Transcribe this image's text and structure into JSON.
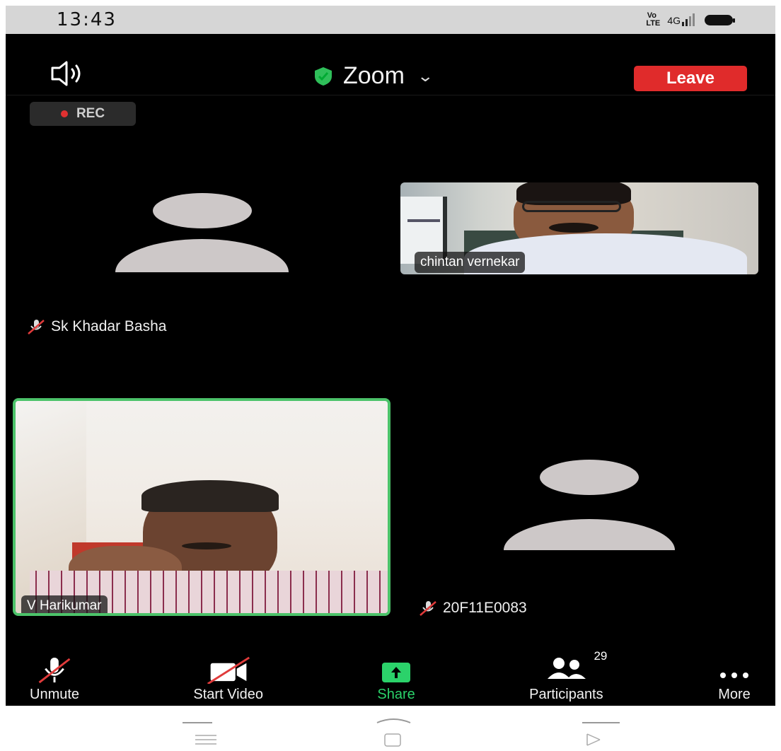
{
  "status": {
    "time": "13:43",
    "volte": "Vo\nLTE",
    "network": "4G"
  },
  "meeting": {
    "title": "Zoom",
    "leave_label": "Leave",
    "rec_label": "REC"
  },
  "participants": {
    "tile1_name": "Sk Khadar Basha",
    "tile2_name": "chintan vernekar",
    "tile3_name": "V Harikumar",
    "tile4_name": "20F11E0083"
  },
  "toolbar": {
    "unmute_label": "Unmute",
    "start_video_label": "Start Video",
    "share_label": "Share",
    "participants_label": "Participants",
    "participants_count": "29",
    "more_label": "More"
  },
  "colors": {
    "leave": "#e02b2b",
    "share": "#2bd26a",
    "active_speaker_border": "#4cc36a",
    "shield": "#2fbf5a"
  },
  "icons": [
    "speaker-icon",
    "shield-check-icon",
    "chevron-down-icon",
    "mic-muted-icon",
    "video-off-icon",
    "share-arrow-icon",
    "participants-icon",
    "more-icon"
  ]
}
